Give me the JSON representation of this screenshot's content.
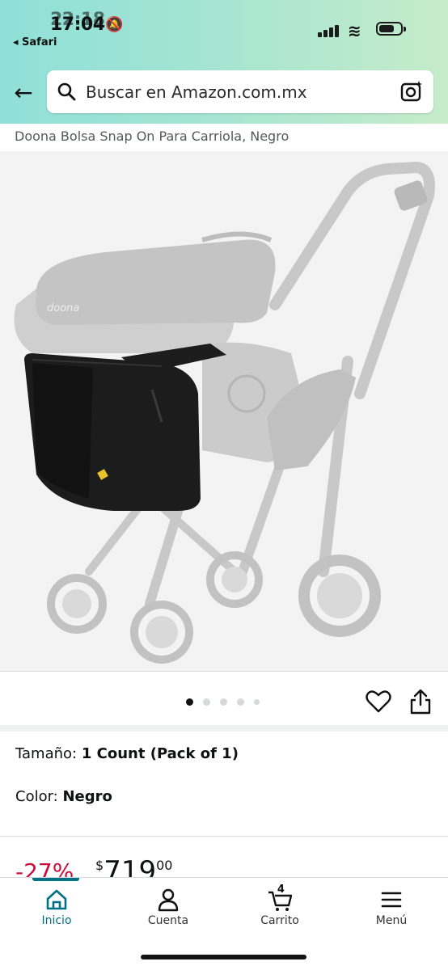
{
  "status": {
    "time": "17:04",
    "time_overlay": "22:18",
    "back_app": "◂ Safari"
  },
  "search": {
    "placeholder": "Buscar en Amazon.com.mx"
  },
  "product": {
    "title": "Doona Bolsa Snap On Para Carriola, Negro",
    "image_brand_lettering": "doona",
    "gallery": {
      "total_images": 5,
      "current_index": 1
    }
  },
  "variants": {
    "size_label": "Tamaño:",
    "size_value": "1 Count (Pack of 1)",
    "color_label": "Color:",
    "color_value": "Negro"
  },
  "pricing": {
    "discount": "-27%",
    "currency_symbol": "$",
    "whole": "719",
    "cents": "00"
  },
  "tabbar": {
    "home": "Inicio",
    "account": "Cuenta",
    "cart": "Carrito",
    "cart_count": "4",
    "menu": "Menú"
  },
  "colors": {
    "header_gradient_start": "#8fe0d8",
    "header_gradient_end": "#c6ecc9",
    "accent_teal": "#007185",
    "discount_red": "#cc0c39",
    "bag_black": "#1c1c1c",
    "stroller_gray": "#c8c8c8"
  }
}
